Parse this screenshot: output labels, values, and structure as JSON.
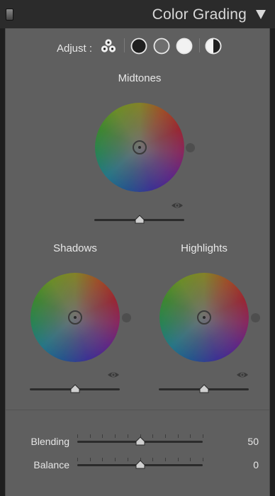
{
  "header": {
    "title": "Color Grading",
    "collapse_icon": "triangle-down-icon"
  },
  "adjust": {
    "label": "Adjust :",
    "modes": [
      {
        "name": "three-way",
        "icon": "three-circles-icon"
      },
      {
        "name": "shadows",
        "icon": "dark-circle-icon"
      },
      {
        "name": "midtones",
        "icon": "gray-circle-icon"
      },
      {
        "name": "highlights",
        "icon": "white-circle-icon"
      },
      {
        "name": "global",
        "icon": "half-circle-icon"
      }
    ],
    "selected": "three-way"
  },
  "wheels": {
    "midtones": {
      "label": "Midtones",
      "luminance": 0.5
    },
    "shadows": {
      "label": "Shadows",
      "luminance": 0.5
    },
    "highlights": {
      "label": "Highlights",
      "luminance": 0.5
    }
  },
  "sliders": {
    "blending": {
      "label": "Blending",
      "value": "50",
      "position": 0.5
    },
    "balance": {
      "label": "Balance",
      "value": "0",
      "position": 0.5
    }
  },
  "colors": {
    "panel_bg": "#5f5f5f",
    "header_bg": "#2b2b2b",
    "text": "#e6e6e6"
  }
}
